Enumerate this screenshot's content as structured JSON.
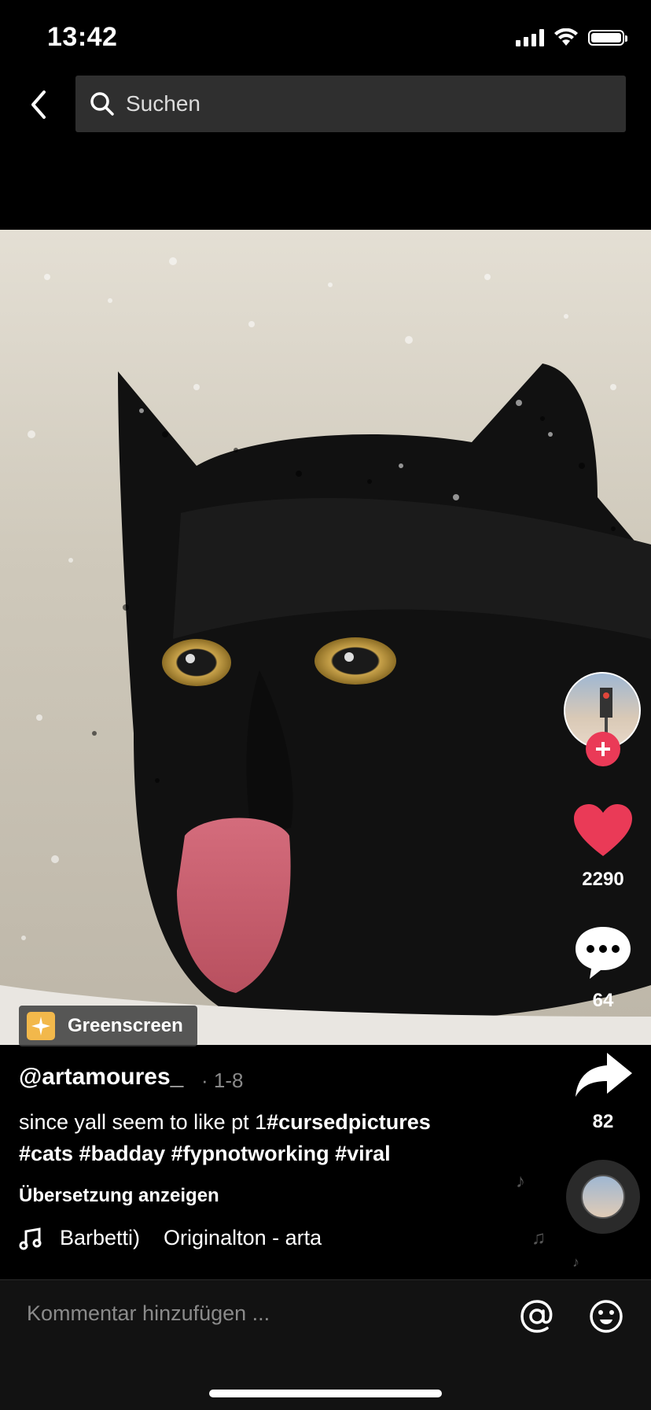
{
  "status_bar": {
    "time": "13:42"
  },
  "search": {
    "placeholder": "Suchen"
  },
  "video": {
    "effect_badge": "Greenscreen"
  },
  "actions": {
    "likes": "2290",
    "comments": "64",
    "shares": "82"
  },
  "post": {
    "username": "@artamoures_",
    "date": "· 1-8",
    "caption_text": "since yall seem to like pt 1",
    "caption_tags_line1": "#cursedpictures",
    "caption_tags_line2": "#cats #badday #fypnotworking #viral",
    "translate_label": "Übersetzung anzeigen",
    "music": "Barbetti)    Originalton - arta"
  },
  "comment_bar": {
    "placeholder": "Kommentar hinzufügen ..."
  },
  "colors": {
    "accent": "#ea3a57",
    "background": "#000000",
    "search_bg": "#2f2f2f"
  }
}
